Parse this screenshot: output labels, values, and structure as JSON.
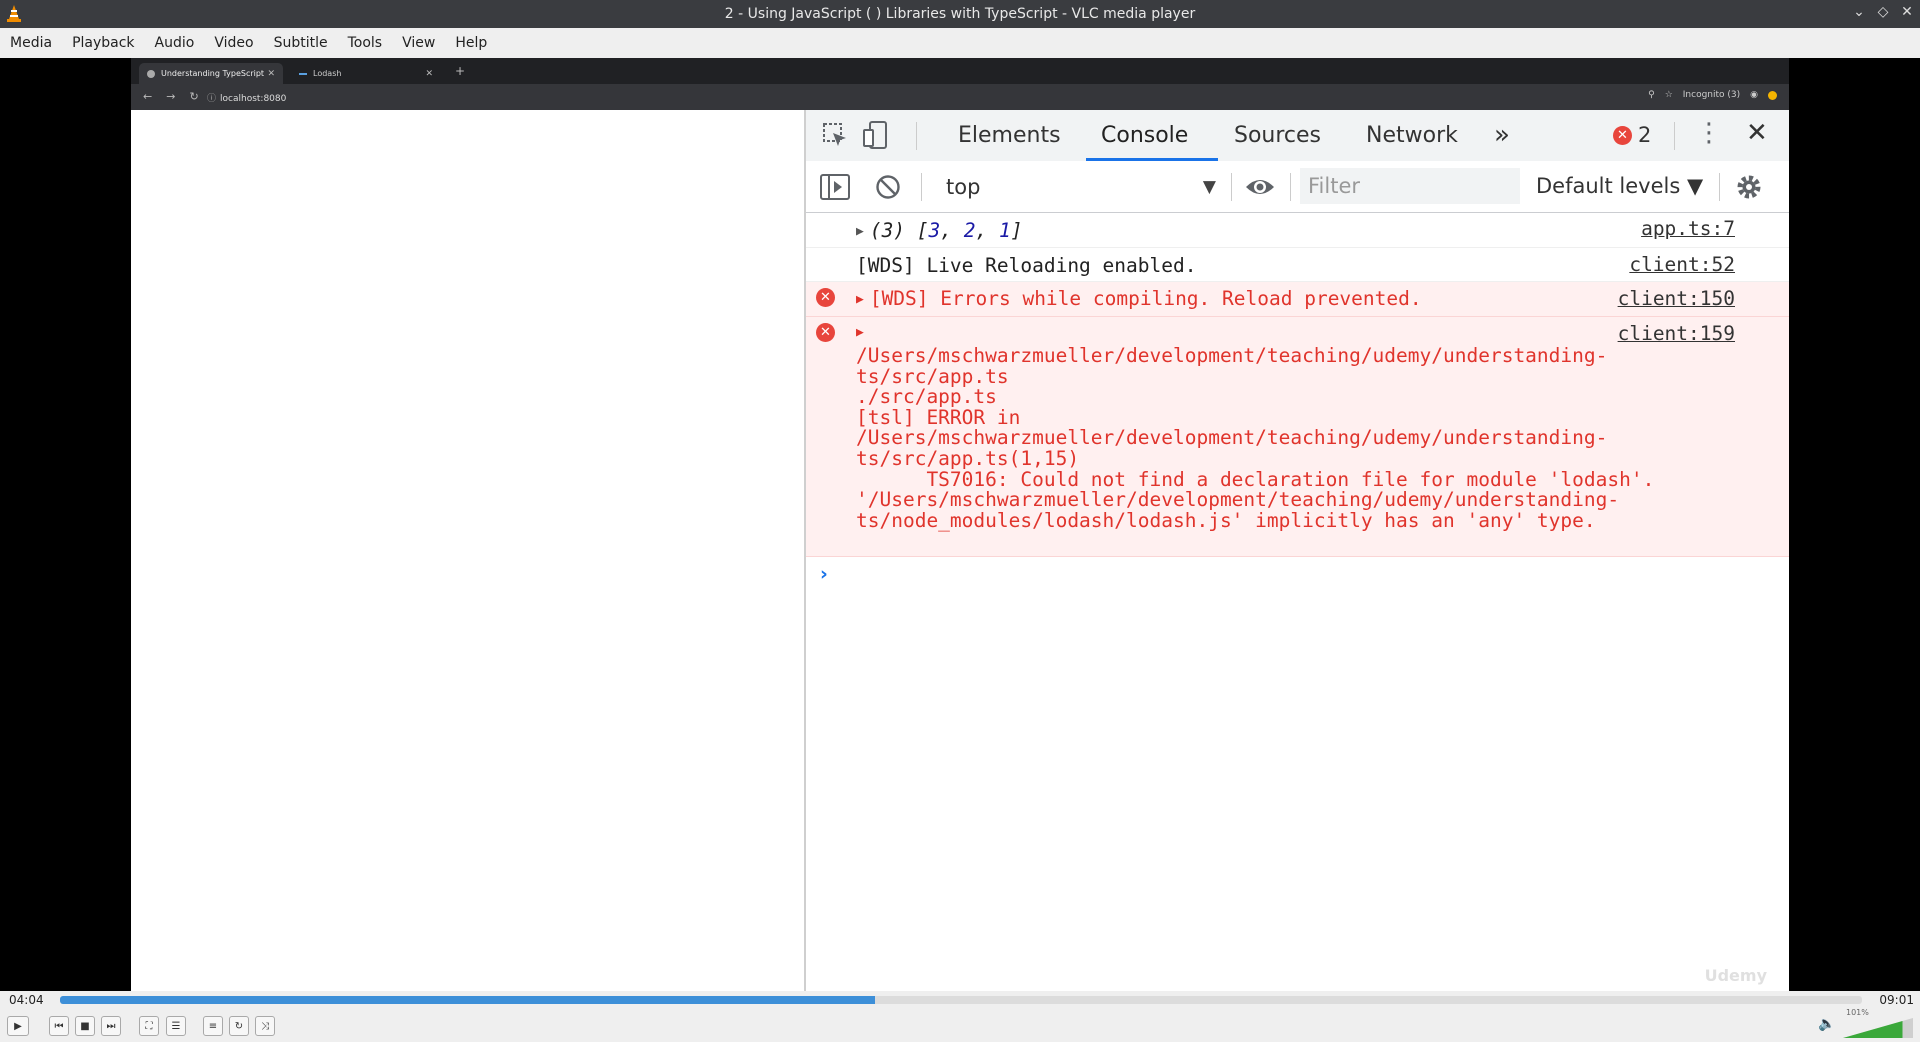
{
  "window": {
    "title": "2 - Using JavaScript ( ) Libraries with TypeScript - VLC media player",
    "controls": [
      "minimize-icon",
      "restore-icon",
      "close-icon"
    ]
  },
  "menu": [
    "Media",
    "Playback",
    "Audio",
    "Video",
    "Subtitle",
    "Tools",
    "View",
    "Help"
  ],
  "browser": {
    "tabs": [
      {
        "label": "Understanding TypeScript",
        "active": true
      },
      {
        "label": "Lodash",
        "active": false
      }
    ],
    "url": "localhost:8080",
    "profile_label": "Incognito (3)"
  },
  "devtools": {
    "tabs": [
      "Elements",
      "Console",
      "Sources",
      "Network"
    ],
    "active_tab": "Console",
    "more_tabs": "»",
    "error_count": "2",
    "context": "top",
    "filter_placeholder": "Filter",
    "levels": "Default levels ▼",
    "messages": [
      {
        "type": "log",
        "text_prefix": "(3) [",
        "nums": [
          "3",
          "2",
          "1"
        ],
        "text_suffix": "]",
        "source": "app.ts:7"
      },
      {
        "type": "log",
        "text": "[WDS] Live Reloading enabled.",
        "source": "client:52"
      },
      {
        "type": "error",
        "text": "[WDS] Errors while compiling. Reload prevented.",
        "source": "client:150"
      },
      {
        "type": "error",
        "source": "client:159",
        "text": "/Users/mschwarzmueller/development/teaching/udemy/understanding-\nts/src/app.ts\n./src/app.ts\n[tsl] ERROR in\n/Users/mschwarzmueller/development/teaching/udemy/understanding-\nts/src/app.ts(1,15)\n      TS7016: Could not find a declaration file for module 'lodash'.\n'/Users/mschwarzmueller/development/teaching/udemy/understanding-\nts/node_modules/lodash/lodash.js' implicitly has an 'any' type."
      }
    ],
    "watermark": "Udemy"
  },
  "player": {
    "elapsed": "04:04",
    "total": "09:01",
    "progress_fraction": 0.452,
    "volume_label": "101%",
    "volume_fraction": 0.85,
    "accent_color": "#3d8fd8"
  }
}
